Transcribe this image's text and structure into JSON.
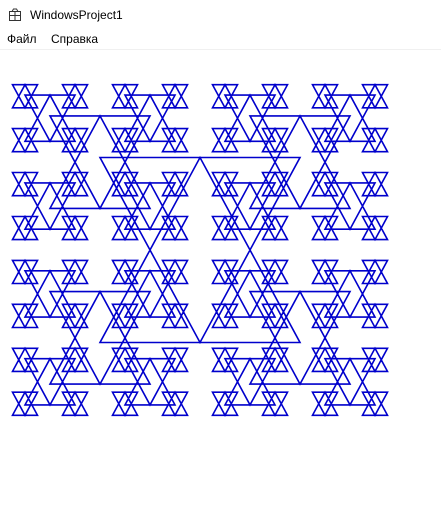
{
  "window": {
    "title": "WindowsProject1",
    "icon": "app-window-icon"
  },
  "menu": {
    "items": [
      {
        "label": "Файл"
      },
      {
        "label": "Справка"
      }
    ]
  },
  "canvas": {
    "stroke_color": "#0000cc",
    "background_color": "#ffffff",
    "figure": "nested-triangle-fractal"
  }
}
